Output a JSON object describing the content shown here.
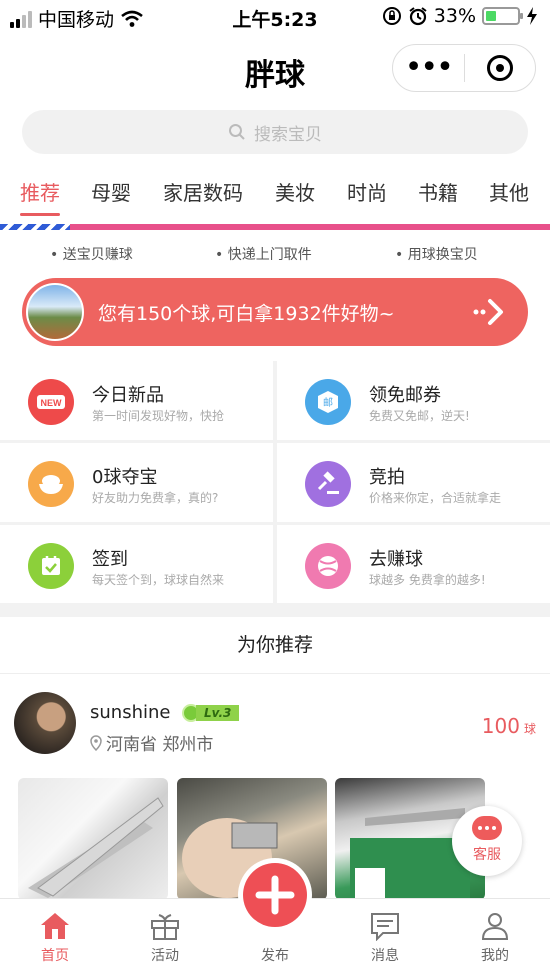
{
  "status_bar": {
    "carrier": "中国移动",
    "time": "上午5:23",
    "battery": "33%",
    "battery_level": 0.33
  },
  "nav": {
    "title": "胖球"
  },
  "search": {
    "placeholder": "搜索宝贝"
  },
  "tabs": [
    {
      "label": "推荐",
      "active": true
    },
    {
      "label": "母婴"
    },
    {
      "label": "家居数码"
    },
    {
      "label": "美妆"
    },
    {
      "label": "时尚"
    },
    {
      "label": "书籍"
    },
    {
      "label": "其他"
    }
  ],
  "bullets": [
    "送宝贝赚球",
    "快递上门取件",
    "用球换宝贝"
  ],
  "banner": {
    "text": "您有150个球,可白拿1932件好物~"
  },
  "features": [
    {
      "title": "今日新品",
      "sub": "第一时间发现好物，快抢",
      "icon": "new-icon",
      "color": "#ee4a4a"
    },
    {
      "title": "领免邮券",
      "sub": "免费又免邮，逆天!",
      "icon": "coupon-icon",
      "color": "#4aa8e8"
    },
    {
      "title": "0球夺宝",
      "sub": "好友助力免费拿，真的?",
      "icon": "treasure-bowl-icon",
      "color": "#f7a94a"
    },
    {
      "title": "竞拍",
      "sub": "价格来你定，合适就拿走",
      "icon": "auction-gavel-icon",
      "color": "#a070e0"
    },
    {
      "title": "签到",
      "sub": "每天签个到，球球自然来",
      "icon": "calendar-check-icon",
      "color": "#8cd03a"
    },
    {
      "title": "去赚球",
      "sub": "球越多 免费拿的越多!",
      "icon": "ball-icon",
      "color": "#f07ab0"
    }
  ],
  "recommend": {
    "title": "为你推荐"
  },
  "user_card": {
    "name": "sunshine",
    "level": "Lv.3",
    "location": "河南省 郑州市",
    "points": "100",
    "points_unit": "球"
  },
  "service": {
    "label": "客服"
  },
  "tabbar": [
    {
      "label": "首页",
      "icon": "home-icon",
      "active": true
    },
    {
      "label": "活动",
      "icon": "gift-icon"
    },
    {
      "label": "发布",
      "icon": "plus-icon"
    },
    {
      "label": "消息",
      "icon": "message-icon"
    },
    {
      "label": "我的",
      "icon": "profile-icon"
    }
  ],
  "colors": {
    "accent": "#e85b5f",
    "banner": "#ee6460",
    "stripe": "#e8508a"
  }
}
